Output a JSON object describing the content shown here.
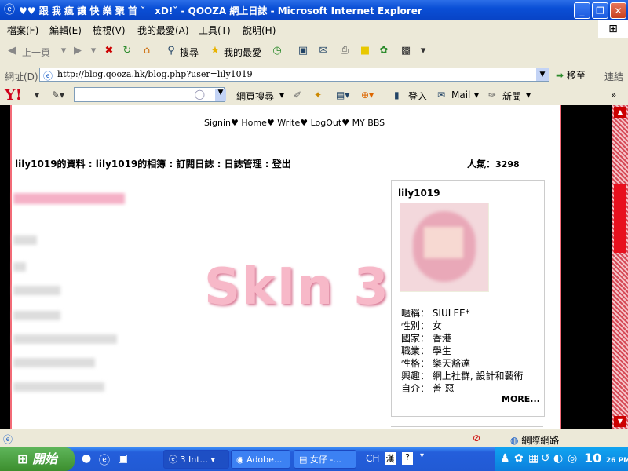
{
  "window": {
    "title": "♥♥ 跟 我 瘋 讓 快 樂 聚 首 ˇ　xD!ˇ - QOOZA 網上日誌 - Microsoft Internet Explorer"
  },
  "menu": [
    "檔案(F)",
    "編輯(E)",
    "檢視(V)",
    "我的最愛(A)",
    "工具(T)",
    "說明(H)"
  ],
  "toolbar": {
    "back_label": "上一頁",
    "search_label": "搜尋",
    "favorites_label": "我的最愛"
  },
  "address": {
    "label": "網址(D)",
    "url": "http://blog.qooza.hk/blog.php?user=lily1019",
    "go_label": "移至",
    "links_label": "連結"
  },
  "yahoo": {
    "logo": "Y!",
    "search_label": "網頁搜尋",
    "signin_label": "登入",
    "mail_label": "Mail",
    "news_label": "新聞"
  },
  "blog": {
    "topnav": "Signin♥ Home♥ Write♥ LogOut♥ MY BBS",
    "usernav": "lily1019的資料 : lily1019的相簿 : 訂閱日誌 : 日誌管理 : 登出",
    "popularity_label": "人氣：",
    "popularity_value": "3298",
    "skin_text": "SkIn 3",
    "profile": {
      "name": "lily1019",
      "rows": [
        "暱稱： SIULEE*",
        "性別： 女",
        "國家： 香港",
        "職業： 學生",
        "性格： 樂天豁達",
        "興趣： 網上社群, 設計和藝術",
        "自介： 善 惡"
      ],
      "more_label": "MORE..."
    }
  },
  "statusbar": {
    "zone": "網際網路"
  },
  "taskbar": {
    "start_label": "開始",
    "tasks": [
      "3 Int...",
      "Adobe...",
      "女仔 -..."
    ],
    "lang": "CH",
    "clock": "10",
    "clock_small": "26 PM"
  }
}
